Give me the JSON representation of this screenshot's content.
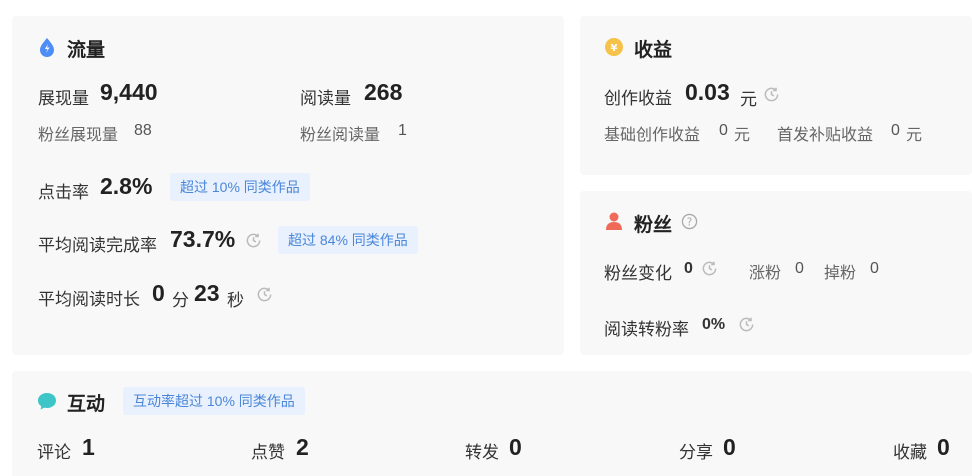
{
  "traffic": {
    "title": "流量",
    "impressions_label": "展现量",
    "impressions_value": "9,440",
    "reads_label": "阅读量",
    "reads_value": "268",
    "fan_impressions_label": "粉丝展现量",
    "fan_impressions_value": "88",
    "fan_reads_label": "粉丝阅读量",
    "fan_reads_value": "1",
    "ctr_label": "点击率",
    "ctr_value": "2.8%",
    "ctr_badge": "超过 10% 同类作品",
    "completion_label": "平均阅读完成率",
    "completion_value": "73.7%",
    "completion_badge": "超过 84% 同类作品",
    "duration_label": "平均阅读时长",
    "duration_min": "0",
    "duration_min_unit": "分",
    "duration_sec": "23",
    "duration_sec_unit": "秒"
  },
  "earnings": {
    "title": "收益",
    "creation_label": "创作收益",
    "creation_value": "0.03",
    "creation_unit": "元",
    "base_label": "基础创作收益",
    "base_value": "0",
    "base_unit": "元",
    "subsidy_label": "首发补贴收益",
    "subsidy_value": "0",
    "subsidy_unit": "元"
  },
  "fans": {
    "title": "粉丝",
    "change_label": "粉丝变化",
    "change_value": "0",
    "gain_label": "涨粉",
    "gain_value": "0",
    "loss_label": "掉粉",
    "loss_value": "0",
    "conversion_label": "阅读转粉率",
    "conversion_value": "0%"
  },
  "interaction": {
    "title": "互动",
    "badge": "互动率超过 10% 同类作品",
    "comments_label": "评论",
    "comments_value": "1",
    "likes_label": "点赞",
    "likes_value": "2",
    "shares_label": "转发",
    "shares_value": "0",
    "forwards_label": "分享",
    "forwards_value": "0",
    "favorites_label": "收藏",
    "favorites_value": "0"
  },
  "icons": {
    "traffic": "water-drop-icon",
    "earnings": "coin-icon",
    "fans": "person-icon",
    "interaction": "chat-bubble-icon",
    "history": "clock-icon",
    "help": "question-icon"
  },
  "colors": {
    "traffic_icon": "#4e8df5",
    "earnings_icon": "#f5c24a",
    "fans_icon": "#f06a5a",
    "interaction_icon": "#3ec5c7",
    "badge_text": "#4a86d9",
    "badge_bg": "#e8f1fd"
  }
}
